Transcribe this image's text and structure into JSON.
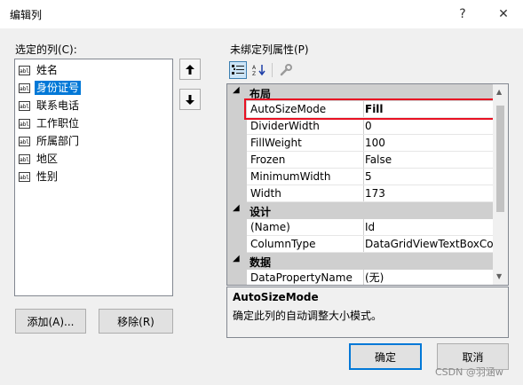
{
  "window": {
    "title": "编辑列",
    "help_glyph": "?",
    "close_glyph": "✕"
  },
  "left": {
    "selected_columns_label": "选定的列(C):",
    "items": [
      {
        "icon": "abl",
        "label": "姓名",
        "selected": false
      },
      {
        "icon": "abl",
        "label": "身份证号",
        "selected": true
      },
      {
        "icon": "abl",
        "label": "联系电话",
        "selected": false
      },
      {
        "icon": "abl",
        "label": "工作职位",
        "selected": false
      },
      {
        "icon": "abl",
        "label": "所属部门",
        "selected": false
      },
      {
        "icon": "abl",
        "label": "地区",
        "selected": false
      },
      {
        "icon": "abl",
        "label": "性别",
        "selected": false
      }
    ],
    "move_up_glyph": "🡅",
    "move_down_glyph": "🡇",
    "add_label": "添加(A)...",
    "remove_label": "移除(R)"
  },
  "right": {
    "unbound_props_label": "未绑定列属性(P)",
    "toolbar": {
      "categorized_icon": "categorized-icon",
      "alphabetical_icon": "alphabetical-icon",
      "property_pages_icon": "wrench-icon"
    },
    "grid": {
      "categories": [
        {
          "name": "布局",
          "properties": [
            {
              "name": "AutoSizeMode",
              "value": "Fill",
              "highlighted": true
            },
            {
              "name": "DividerWidth",
              "value": "0"
            },
            {
              "name": "FillWeight",
              "value": "100"
            },
            {
              "name": "Frozen",
              "value": "False"
            },
            {
              "name": "MinimumWidth",
              "value": "5"
            },
            {
              "name": "Width",
              "value": "173"
            }
          ]
        },
        {
          "name": "设计",
          "properties": [
            {
              "name": "(Name)",
              "value": "Id"
            },
            {
              "name": "ColumnType",
              "value": "DataGridViewTextBoxColu"
            }
          ]
        },
        {
          "name": "数据",
          "properties": [
            {
              "name": "DataPropertyName",
              "value": "(无)"
            }
          ]
        }
      ]
    },
    "description": {
      "title": "AutoSizeMode",
      "text": "确定此列的自动调整大小模式。"
    }
  },
  "footer": {
    "ok_label": "确定",
    "cancel_label": "取消",
    "watermark": "CSDN @羽涵w"
  },
  "colors": {
    "selection": "#0078d7",
    "highlight_box": "#e81123",
    "category_bg": "#cfcfcf"
  }
}
